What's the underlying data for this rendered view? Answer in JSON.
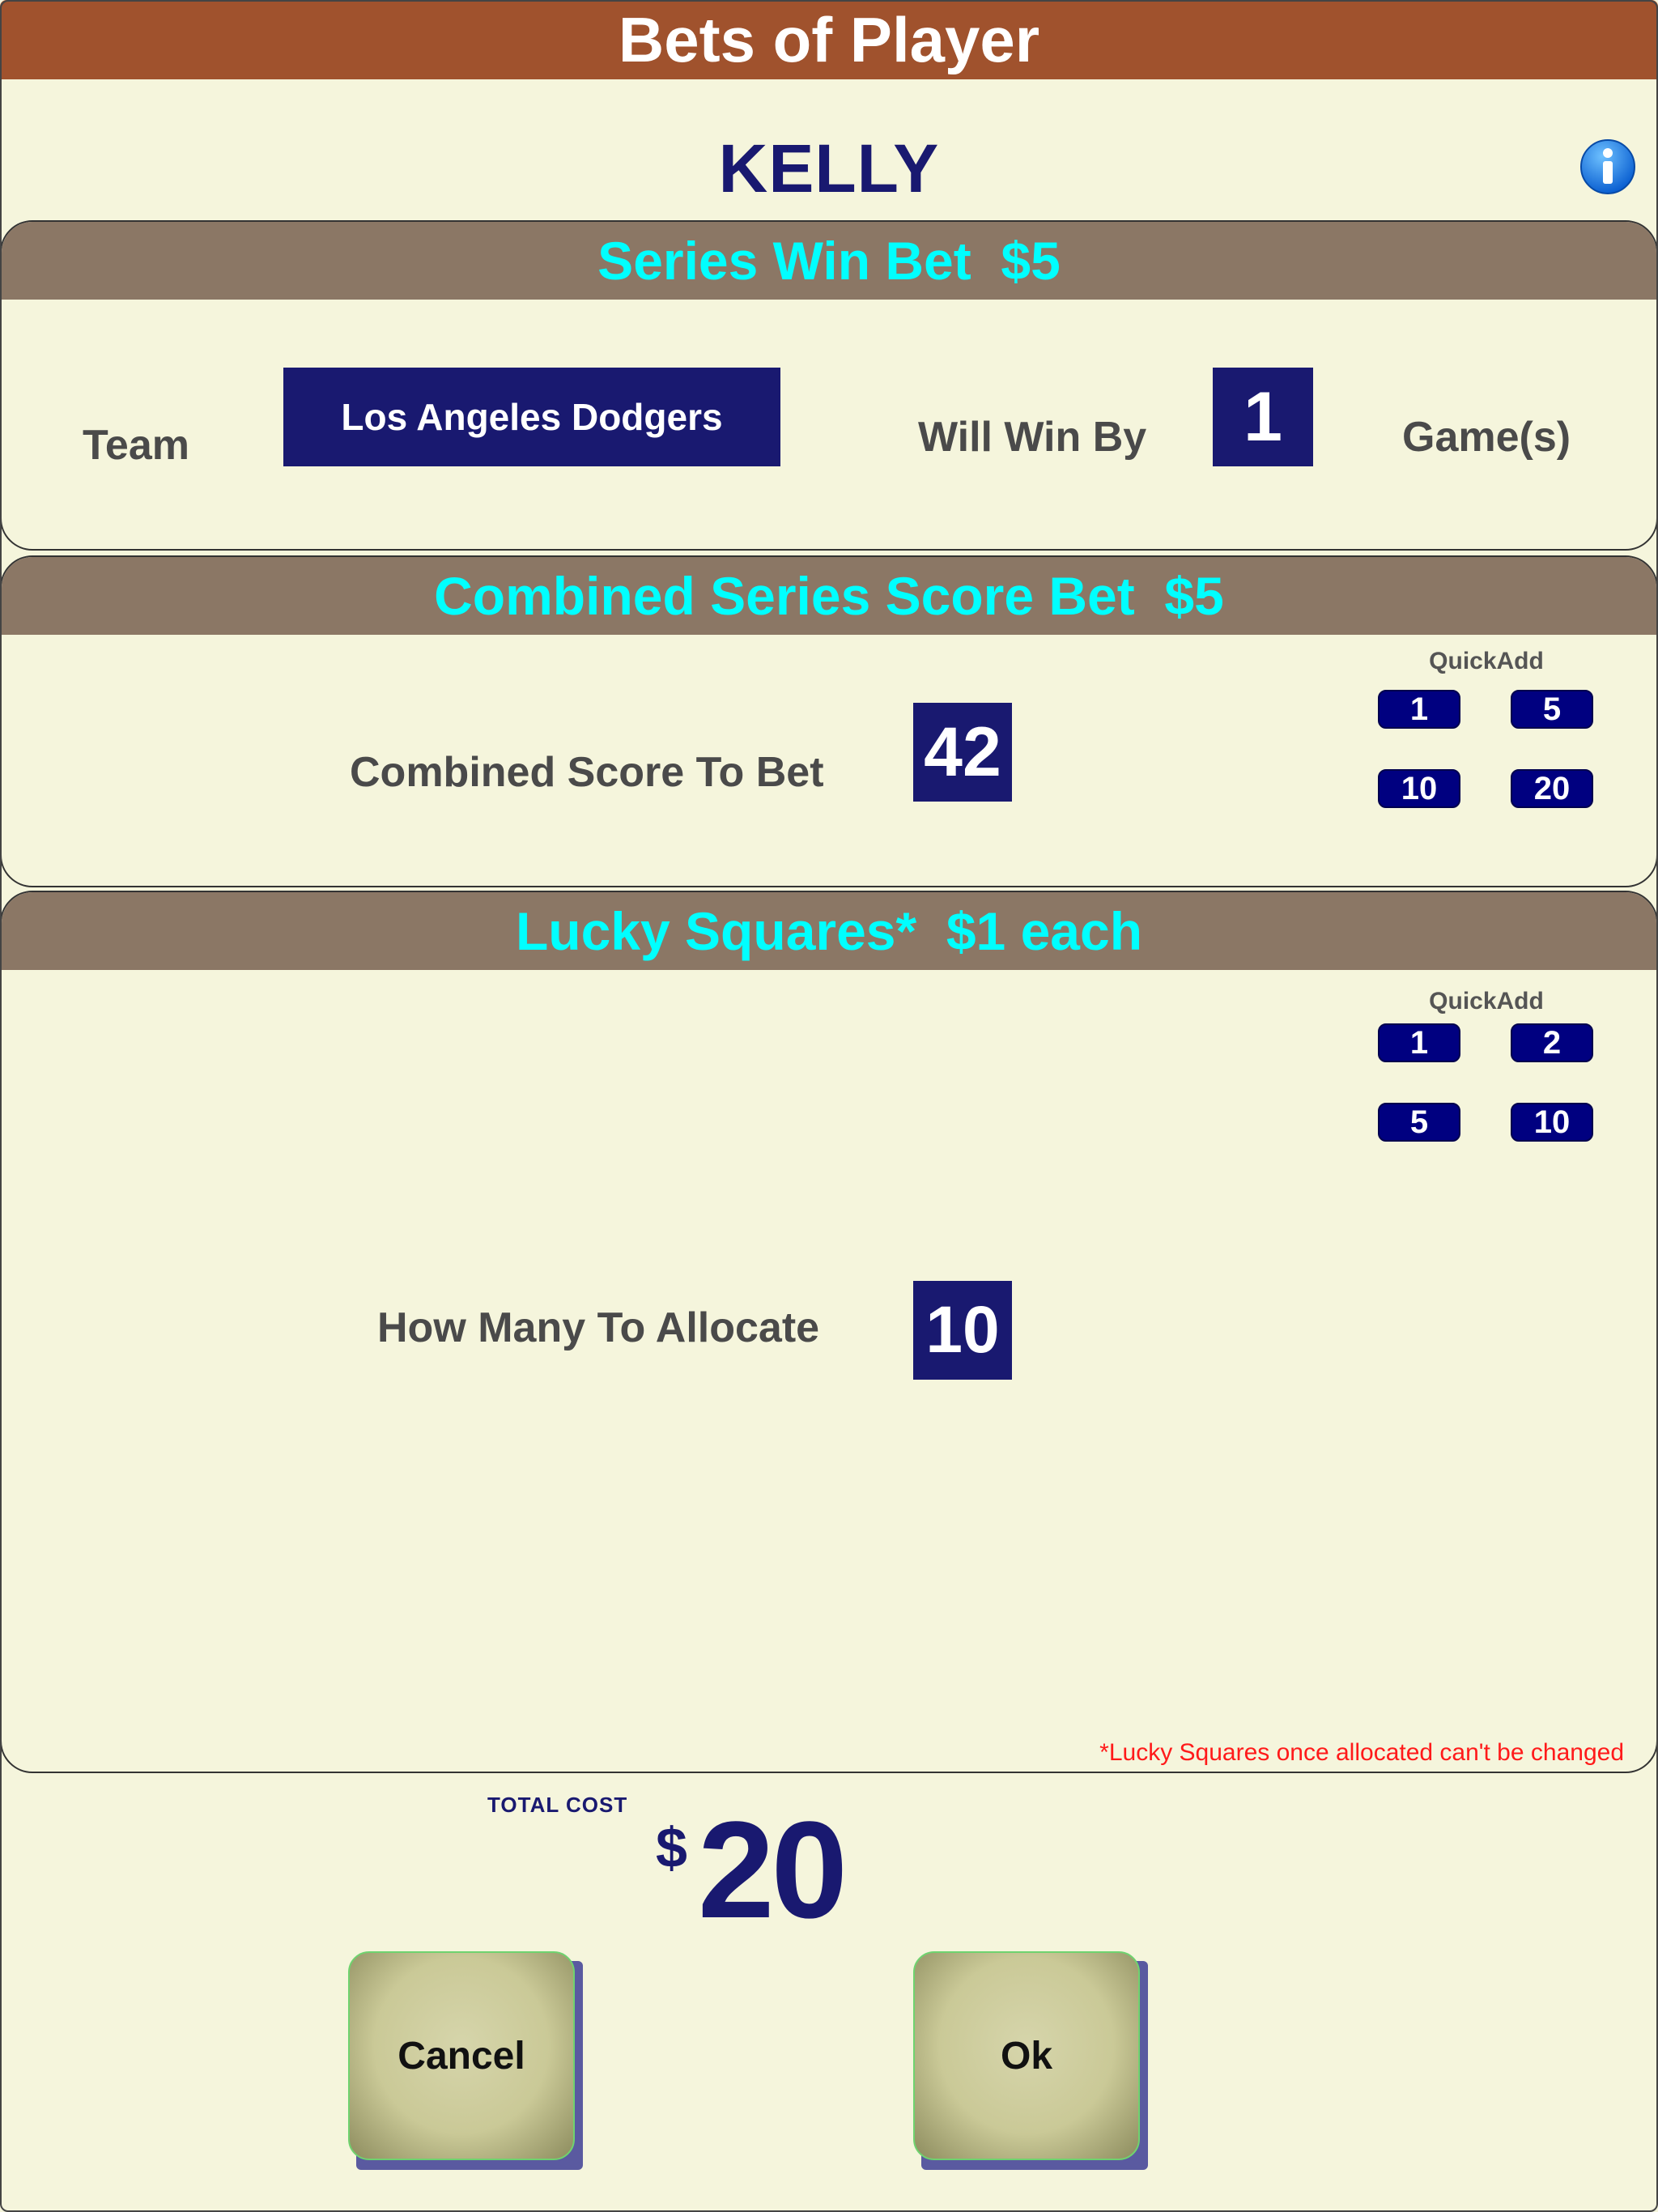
{
  "window": {
    "title": "Bets of Player"
  },
  "player": {
    "name": "KELLY",
    "info_icon": "info-icon"
  },
  "series_win": {
    "header": "Series Win Bet  $5",
    "team_label": "Team",
    "team_value": "Los Angeles Dodgers",
    "win_by_label": "Will Win By",
    "win_by_value": "1",
    "games_label": "Game(s)"
  },
  "combined_score": {
    "header": "Combined Series Score Bet  $5",
    "label": "Combined Score To Bet",
    "value": "42",
    "quickadd_label": "QuickAdd",
    "quickadd": [
      "1",
      "5",
      "10",
      "20"
    ]
  },
  "lucky_squares": {
    "header": "Lucky Squares*  $1 each",
    "label": "How Many To Allocate",
    "value": "10",
    "quickadd_label": "QuickAdd",
    "quickadd": [
      "1",
      "2",
      "5",
      "10"
    ],
    "note": "*Lucky Squares once allocated can't be changed"
  },
  "total": {
    "label": "TOTAL COST",
    "currency": "$",
    "value": "20"
  },
  "buttons": {
    "cancel": "Cancel",
    "ok": "Ok"
  },
  "colors": {
    "title_bar": "#a0522d",
    "background": "#f5f5dc",
    "section_header": "#8b7765",
    "header_text": "#00ffff",
    "navy": "#191970",
    "note": "#ff1a1a"
  }
}
